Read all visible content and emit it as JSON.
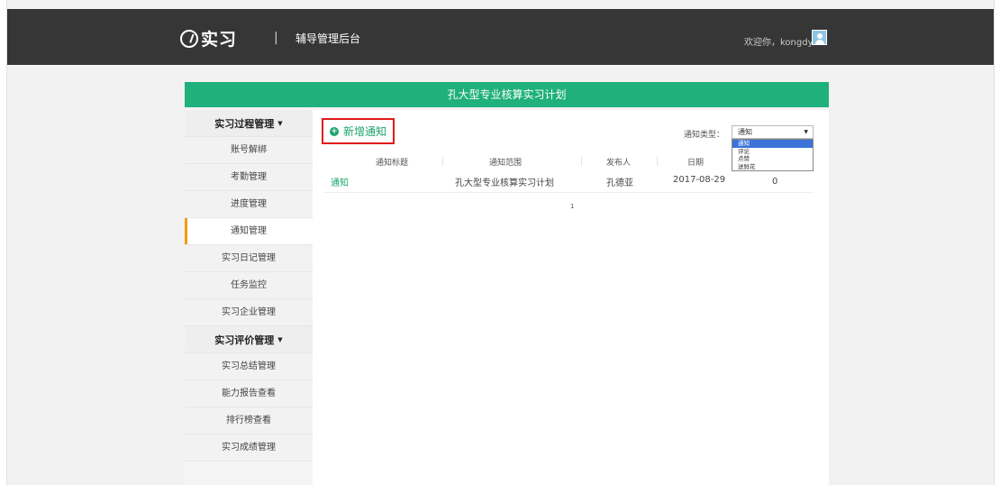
{
  "header": {
    "logo_text": "实习",
    "separator": "|",
    "subtitle": "辅导管理后台",
    "welcome": "欢迎你，kongdyt"
  },
  "banner": {
    "title": "孔大型专业核算实习计划"
  },
  "sidebar": {
    "items": [
      {
        "label": "实习过程管理",
        "type": "header"
      },
      {
        "label": "账号解绑"
      },
      {
        "label": "考勤管理"
      },
      {
        "label": "进度管理"
      },
      {
        "label": "通知管理",
        "active": true
      },
      {
        "label": "实习日记管理"
      },
      {
        "label": "任务监控"
      },
      {
        "label": "实习企业管理"
      },
      {
        "label": "实习评价管理",
        "type": "header"
      },
      {
        "label": "实习总结管理"
      },
      {
        "label": "能力报告查看"
      },
      {
        "label": "排行榜查看"
      },
      {
        "label": "实习成绩管理"
      }
    ]
  },
  "toolbar": {
    "add_label": "新增通知",
    "type_label": "通知类型：",
    "type_selected": "通知",
    "type_options": [
      "通知",
      "评论",
      "点赞",
      "送鲜花"
    ]
  },
  "table": {
    "columns": [
      "通知标题",
      "通知范围",
      "发布人",
      "日期"
    ],
    "rows": [
      {
        "title": "通知",
        "scope": "孔大型专业核算实习计划",
        "publisher": "孔德亚",
        "date": "2017-08-29",
        "extra": "0"
      }
    ]
  },
  "pagination": {
    "current": "1"
  },
  "colors": {
    "accent": "#1fb07c",
    "topbar": "#363636",
    "highlight_border": "#e01b1b",
    "active_marker": "#f39c12"
  }
}
